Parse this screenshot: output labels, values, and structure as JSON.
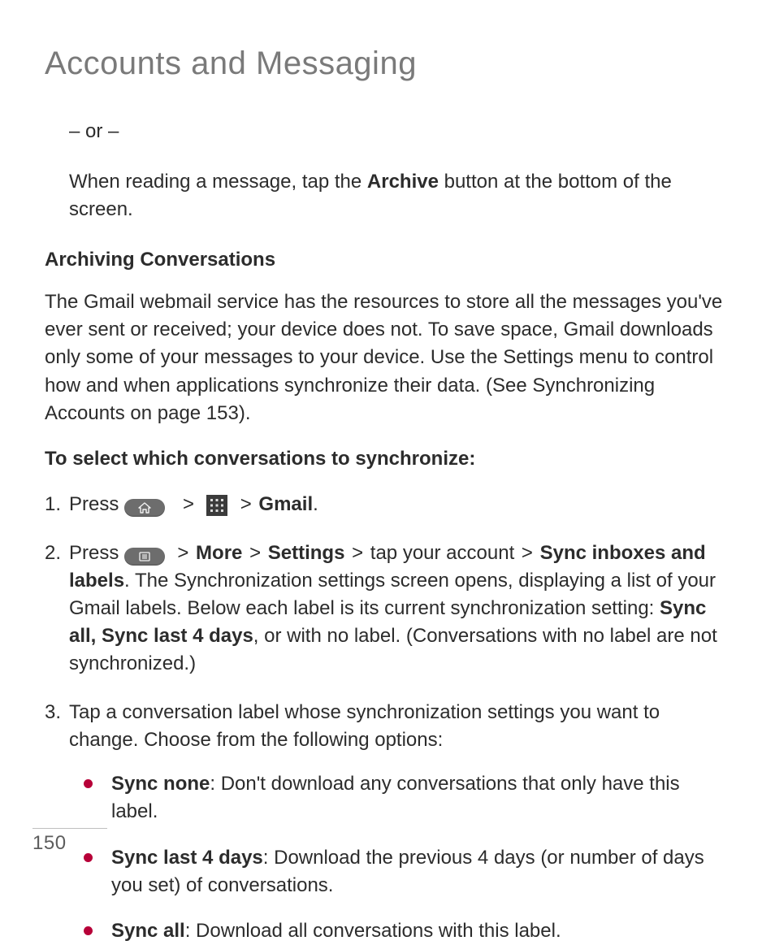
{
  "pageNumber": "150",
  "title": "Accounts and Messaging",
  "or_text": "– or –",
  "intro_pre": "When reading a message, tap the ",
  "intro_b": "Archive",
  "intro_post": " button at the bottom of the screen.",
  "heading_archiving": "Archiving Conversations",
  "archiving_para": "The Gmail webmail service has the resources to store all the messages you've ever sent or received; your device does not. To save space, Gmail downloads only some of your messages to your device. Use the Settings menu to control how and when applications synchronize their data. (See Synchronizing Accounts on page 153).",
  "heading_select": "To select which conversations to synchronize:",
  "step1_pre": "Press  ",
  "step1_post_b": "Gmail",
  "step1_post": ".",
  "step2_pre": "Press  ",
  "step2_more": "More",
  "step2_settings": "Settings",
  "step2_mid": " tap your account ",
  "step2_sync": "Sync inboxes and labels",
  "step2_body1": "The Synchronization settings screen opens, displaying a list of your Gmail labels. Below each label is its current synchronization setting: ",
  "step2_syncall": "Sync all, Sync last 4 days",
  "step2_body2": ", or with no label. (Conversations with no label are not synchronized.)",
  "step3_body": "Tap a conversation label whose synchronization settings you want to change. Choose from the following options:",
  "bullet1_b": "Sync none",
  "bullet1_t": ": Don't download any conversations that only have this label.",
  "bullet2_b": "Sync last 4 days",
  "bullet2_t": ": Download the previous 4 days (or number of days you set) of conversations.",
  "bullet3_b": "Sync all",
  "bullet3_t": ": Download all conversations with this label.",
  "gt": ">"
}
